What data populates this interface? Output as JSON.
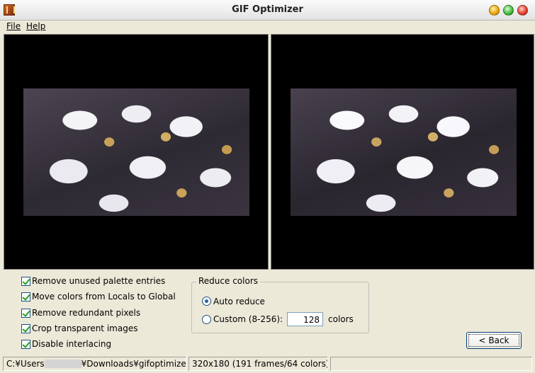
{
  "window": {
    "title": "GIF Optimizer"
  },
  "menu": {
    "file": "File",
    "help": "Help"
  },
  "options": [
    {
      "label": "Remove unused palette entries",
      "checked": true
    },
    {
      "label": "Move colors from Locals to Global",
      "checked": true
    },
    {
      "label": "Remove redundant pixels",
      "checked": true
    },
    {
      "label": "Crop transparent images",
      "checked": true
    },
    {
      "label": "Disable interlacing",
      "checked": true
    }
  ],
  "reduce_colors": {
    "title": "Reduce colors",
    "auto_label": "Auto reduce",
    "custom_label": "Custom (8-256):",
    "value": "128",
    "suffix": "colors",
    "selected": "auto"
  },
  "buttons": {
    "back": "< Back"
  },
  "status": {
    "path_prefix": "C:¥Users",
    "path_suffix": "¥Downloads¥gifoptimizer¥W",
    "info": "320x180 (191 frames/64 colors)"
  },
  "icons": {
    "app": "gif-optimizer-app-icon"
  }
}
